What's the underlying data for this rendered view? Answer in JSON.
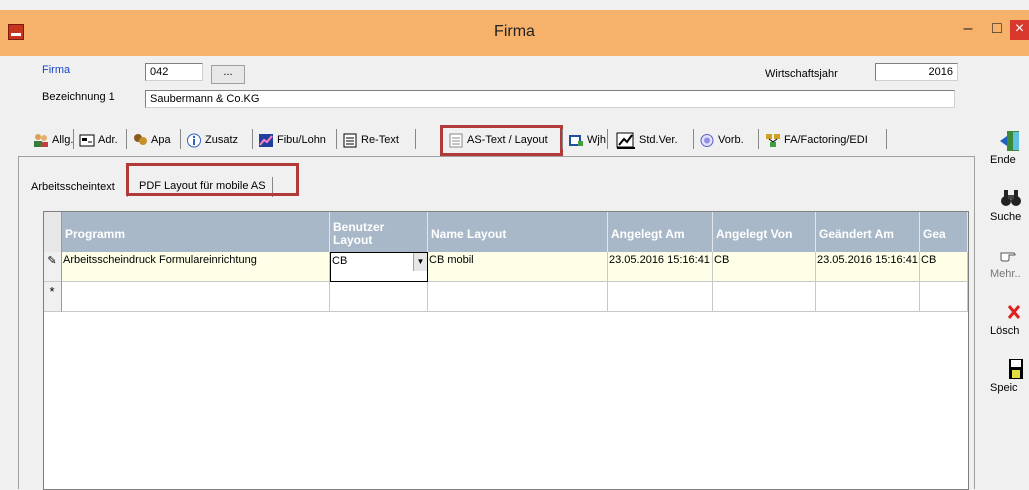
{
  "window": {
    "title": "Firma",
    "min_glyph": "–",
    "max_glyph": "□",
    "close_glyph": "×"
  },
  "form": {
    "firma_label": "Firma",
    "firma_value": "042",
    "browse_label": "...",
    "bezeichnung_label": "Bezeichnung 1",
    "bezeichnung_value": "Saubermann & Co.KG",
    "wirtschaftsjahr_label": "Wirtschaftsjahr",
    "wirtschaftsjahr_value": "2016"
  },
  "tabs": [
    {
      "label": "Allg.",
      "icon": "people-icon"
    },
    {
      "label": "Adr.",
      "icon": "address-card-icon"
    },
    {
      "label": "Apa",
      "icon": "contacts-icon"
    },
    {
      "label": "Zusatz",
      "icon": "info-icon"
    },
    {
      "label": "Fibu/Lohn",
      "icon": "chart-icon"
    },
    {
      "label": "Re-Text",
      "icon": "document-icon"
    },
    {
      "label": "AS-Text / Layout",
      "icon": "document-icon",
      "active": true
    },
    {
      "label": "Wjh",
      "icon": "ledger-icon"
    },
    {
      "label": "Std.Ver.",
      "icon": "chart-check-icon"
    },
    {
      "label": "Vorb.",
      "icon": "seal-icon"
    },
    {
      "label": "FA/Factoring/EDI",
      "icon": "network-icon"
    }
  ],
  "subtabs": [
    {
      "label": "Arbeitsscheintext"
    },
    {
      "label": "PDF Layout  für mobile AS",
      "active": true
    }
  ],
  "grid": {
    "columns": [
      "Programm",
      "Benutzer Layout",
      "Name Layout",
      "Angelegt Am",
      "Angelegt Von",
      "Geändert Am",
      "Gea"
    ],
    "rows": [
      {
        "indicator": "✎",
        "cells": [
          "Arbeitsscheindruck Formulareinrichtung",
          "CB",
          "CB mobil",
          "23.05.2016 15:16:41",
          "CB",
          "23.05.2016 15:16:41",
          "CB"
        ]
      },
      {
        "indicator": "*",
        "cells": [
          "",
          "",
          "",
          "",
          "",
          "",
          ""
        ]
      }
    ]
  },
  "sidebar": {
    "buttons": [
      {
        "label": "Ende",
        "icon": "exit-door-icon"
      },
      {
        "label": "Suche",
        "icon": "binoculars-icon"
      },
      {
        "label": "Mehr..",
        "icon": "pointing-hand-icon"
      },
      {
        "label": "Lösch",
        "icon": "delete-x-icon"
      },
      {
        "label": "Speic",
        "icon": "floppy-disk-icon"
      }
    ]
  },
  "colors": {
    "titlebar": "#f6b26a",
    "highlight_box": "#b03a3a",
    "grid_header": "#a8b8c8",
    "row_bg": "#ffffe8",
    "label_blue": "#1a44c8"
  }
}
